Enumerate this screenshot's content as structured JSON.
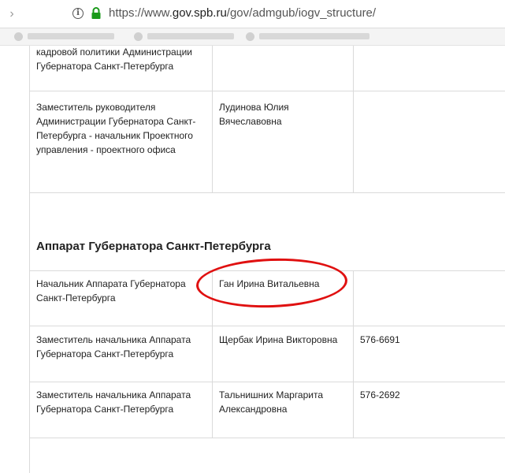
{
  "browser": {
    "url_scheme": "https://www.",
    "url_host": "gov.spb.ru",
    "url_path": "/gov/admgub/iogv_structure/"
  },
  "rows_top": [
    {
      "position": "кадровой политики Администрации Губернатора Санкт-Петербурга",
      "name": "",
      "phone": ""
    },
    {
      "position": "Заместитель руководителя Администрации Губернатора Санкт-Петербурга - начальник Проектного управления - проектного офиса",
      "name": "Лудинова Юлия Вячеславовна",
      "phone": ""
    }
  ],
  "section": {
    "title": "Аппарат Губернатора Санкт-Петербурга"
  },
  "rows_bottom": [
    {
      "position": "Начальник Аппарата Губернатора Санкт-Петербурга",
      "name": "Ган Ирина Витальевна",
      "phone": ""
    },
    {
      "position": "Заместитель начальника Аппарата Губернатора Санкт-Петербурга",
      "name": "Щербак Ирина Викторовна",
      "phone": "576-6691"
    },
    {
      "position": "Заместитель начальника Аппарата Губернатора Санкт-Петербурга",
      "name": "Тальнишних Маргарита Александровна",
      "phone": "576-2692"
    }
  ],
  "annotation_color": "#e01010"
}
